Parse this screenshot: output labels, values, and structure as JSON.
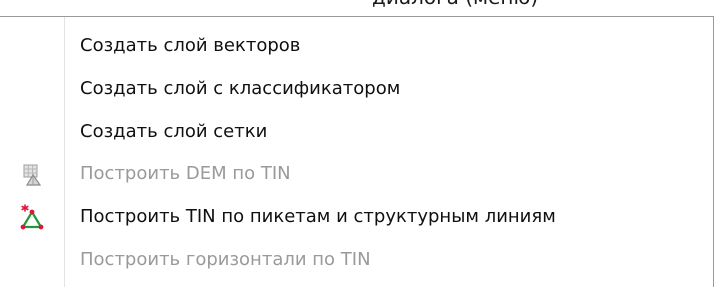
{
  "top_fragment": "диалога (меню)",
  "menu": {
    "items": [
      {
        "label": "Создать слой векторов",
        "enabled": true,
        "icon": null
      },
      {
        "label": "Создать слой с классификатором",
        "enabled": true,
        "icon": null
      },
      {
        "label": "Создать слой сетки",
        "enabled": true,
        "icon": null
      },
      {
        "label": "Построить DEM по TIN",
        "enabled": false,
        "icon": "dem-grid-icon"
      },
      {
        "label": "Построить TIN по пикетам и структурным линиям",
        "enabled": true,
        "icon": "tin-triangle-icon"
      },
      {
        "label": "Построить горизонтали по TIN",
        "enabled": false,
        "icon": null
      }
    ]
  },
  "colors": {
    "text_enabled": "#101010",
    "text_disabled": "#9a9a9a",
    "border": "#9a9a9a",
    "gutter_separator": "#e3e3e3",
    "tin_icon_green": "#1f9a3a",
    "tin_icon_red": "#e0173c"
  }
}
